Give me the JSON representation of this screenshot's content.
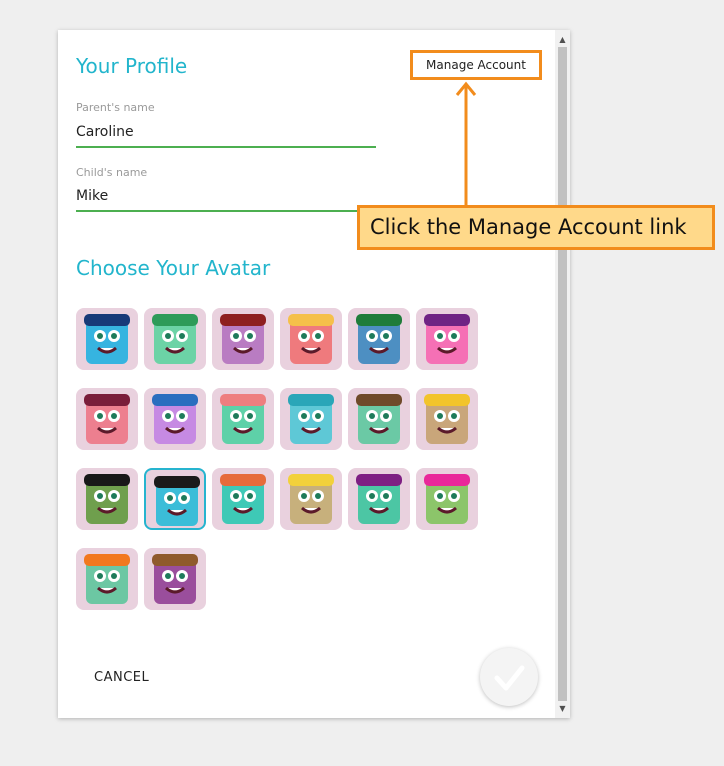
{
  "profile": {
    "title": "Your Profile",
    "manage_account_label": "Manage Account",
    "parent_label": "Parent's name",
    "parent_value": "Caroline",
    "child_label": "Child's name",
    "child_value": "Mike"
  },
  "avatars": {
    "heading": "Choose Your Avatar",
    "selected_index": 13,
    "items": [
      {
        "name": "avatar-1",
        "color": "#36b4e0",
        "hair": "#173a78"
      },
      {
        "name": "avatar-2",
        "color": "#6cd3a6",
        "hair": "#2e9b59"
      },
      {
        "name": "avatar-3",
        "color": "#b97cc2",
        "hair": "#8e1f1f"
      },
      {
        "name": "avatar-4",
        "color": "#ef7a7d",
        "hair": "#f5c04a"
      },
      {
        "name": "avatar-5",
        "color": "#4d8fc2",
        "hair": "#1f7c3a"
      },
      {
        "name": "avatar-6",
        "color": "#f570b5",
        "hair": "#6f2384"
      },
      {
        "name": "avatar-7",
        "color": "#ed7f8f",
        "hair": "#7a1d3a"
      },
      {
        "name": "avatar-8",
        "color": "#c68ae3",
        "hair": "#2a6ebf"
      },
      {
        "name": "avatar-9",
        "color": "#5ed1a8",
        "hair": "#ee7e7f"
      },
      {
        "name": "avatar-10",
        "color": "#5ec8d6",
        "hair": "#2aa6b8"
      },
      {
        "name": "avatar-11",
        "color": "#6bc9a5",
        "hair": "#6f4a2a"
      },
      {
        "name": "avatar-12",
        "color": "#c9a67a",
        "hair": "#f2c42b"
      },
      {
        "name": "avatar-13",
        "color": "#6f9f4d",
        "hair": "#181818"
      },
      {
        "name": "avatar-14",
        "color": "#3bbdd8",
        "hair": "#1b1b1b"
      },
      {
        "name": "avatar-15",
        "color": "#3ec9b6",
        "hair": "#e66b3a"
      },
      {
        "name": "avatar-16",
        "color": "#c7b07c",
        "hair": "#f2d13b"
      },
      {
        "name": "avatar-17",
        "color": "#4cc6a4",
        "hair": "#7e1f83"
      },
      {
        "name": "avatar-18",
        "color": "#8cc56a",
        "hair": "#e9289a"
      },
      {
        "name": "avatar-19",
        "color": "#6cc7a3",
        "hair": "#f2781e"
      },
      {
        "name": "avatar-20",
        "color": "#9a4e9c",
        "hair": "#8f5a2c"
      }
    ]
  },
  "footer": {
    "cancel_label": "CANCEL"
  },
  "callout": {
    "text": "Click the Manage Account link"
  }
}
